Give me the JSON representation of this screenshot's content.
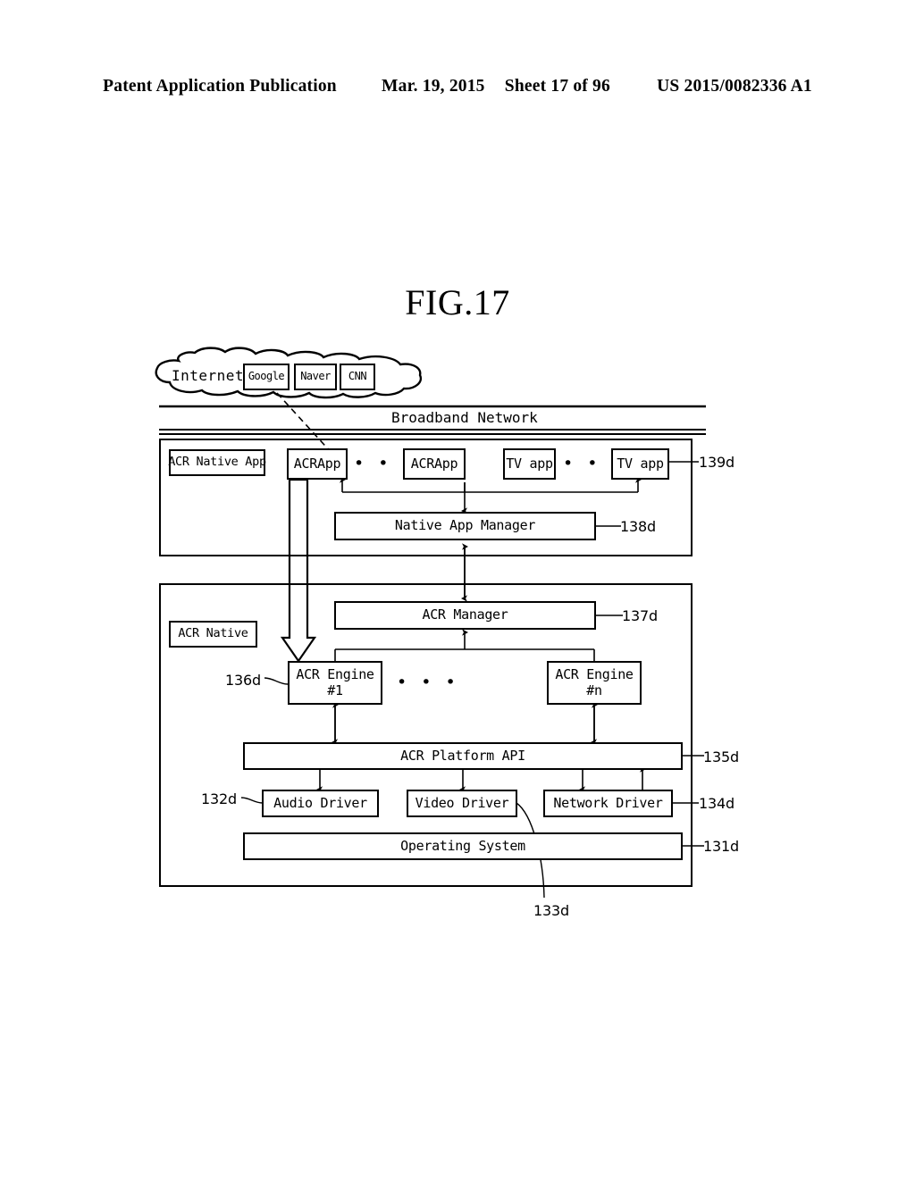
{
  "header": {
    "left": "Patent Application Publication",
    "date": "Mar. 19, 2015",
    "sheet": "Sheet 17 of 96",
    "docnum": "US 2015/0082336 A1"
  },
  "figure": {
    "title": "FIG.17"
  },
  "cloud": {
    "label": "Internet",
    "services": [
      {
        "label": "Google"
      },
      {
        "label": "Naver"
      },
      {
        "label": "CNN"
      }
    ]
  },
  "network_band": {
    "label": "Broadband Network"
  },
  "app_layer": {
    "ref": "139d",
    "native_app": "ACR Native App",
    "acr_app_1": "ACRApp",
    "acr_app_n": "ACRApp",
    "acr_ellipsis": "• • •",
    "tv_app_1": "TV app",
    "tv_app_n": "TV app",
    "tv_ellipsis": "• • •",
    "native_app_manager": "Native App Manager",
    "native_app_manager_ref": "138d"
  },
  "platform_layer": {
    "acr_native": "ACR Native",
    "acr_manager": "ACR Manager",
    "acr_manager_ref": "137d",
    "engine_1": "ACR Engine\n#1",
    "engine_n": "ACR Engine\n#n",
    "engine_ref": "136d",
    "engine_ellipsis": "• • •",
    "platform_api": "ACR Platform API",
    "platform_api_ref": "135d",
    "audio_driver": "Audio Driver",
    "audio_driver_ref": "132d",
    "video_driver": "Video Driver",
    "video_driver_ref": "133d",
    "network_driver": "Network Driver",
    "network_driver_ref": "134d",
    "operating_system": "Operating System",
    "operating_system_ref": "131d"
  },
  "colors": {
    "ink": "#000000",
    "paper": "#ffffff"
  }
}
